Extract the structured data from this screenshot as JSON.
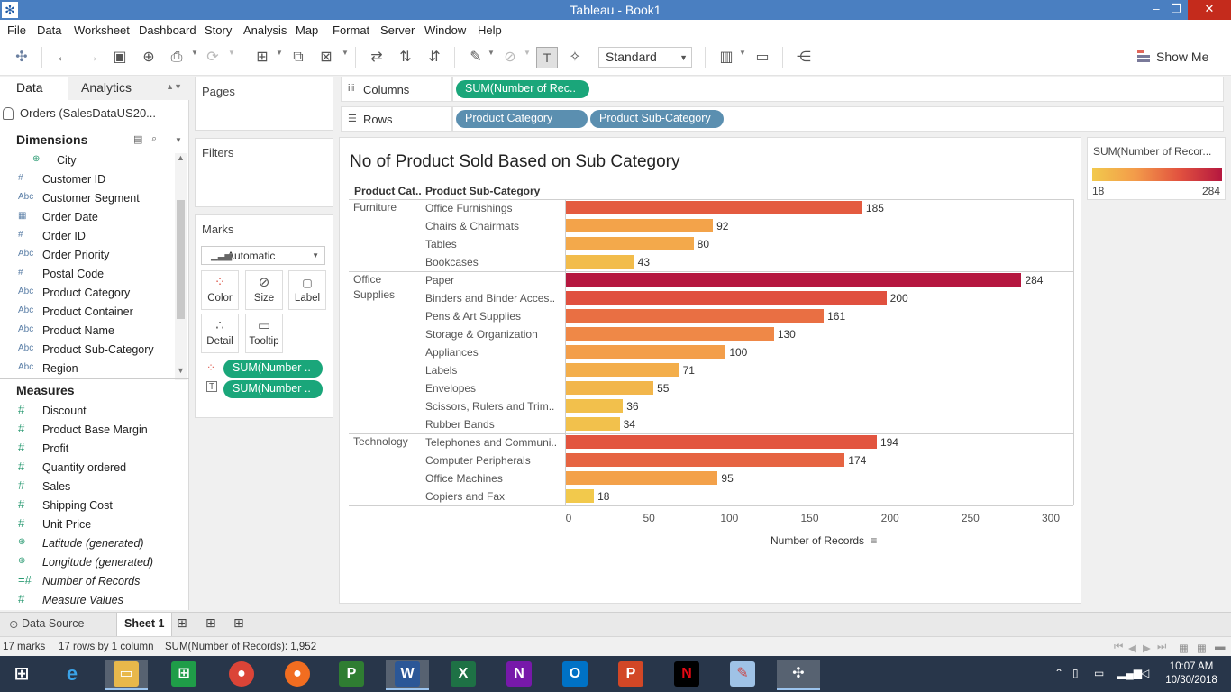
{
  "window": {
    "title": "Tableau - Book1"
  },
  "menu": [
    "File",
    "Data",
    "Worksheet",
    "Dashboard",
    "Story",
    "Analysis",
    "Map",
    "Format",
    "Server",
    "Window",
    "Help"
  ],
  "toolbar": {
    "view_size": "Standard",
    "show_me": "Show Me"
  },
  "data_pane": {
    "tab_data": "Data",
    "tab_analytics": "Analytics",
    "datasource": "Orders (SalesDataUS20...",
    "dimensions_label": "Dimensions",
    "measures_label": "Measures",
    "dimensions": [
      {
        "icon": "geo",
        "name": "City"
      },
      {
        "icon": "#",
        "name": "Customer ID"
      },
      {
        "icon": "Abc",
        "name": "Customer Segment"
      },
      {
        "icon": "date",
        "name": "Order Date"
      },
      {
        "icon": "#",
        "name": "Order ID"
      },
      {
        "icon": "Abc",
        "name": "Order Priority"
      },
      {
        "icon": "#",
        "name": "Postal Code"
      },
      {
        "icon": "Abc",
        "name": "Product Category"
      },
      {
        "icon": "Abc",
        "name": "Product Container"
      },
      {
        "icon": "Abc",
        "name": "Product Name"
      },
      {
        "icon": "Abc",
        "name": "Product Sub-Category"
      },
      {
        "icon": "Abc",
        "name": "Region"
      }
    ],
    "measures": [
      {
        "icon": "#",
        "name": "Discount"
      },
      {
        "icon": "#",
        "name": "Product Base Margin"
      },
      {
        "icon": "#",
        "name": "Profit"
      },
      {
        "icon": "#",
        "name": "Quantity ordered"
      },
      {
        "icon": "#",
        "name": "Sales"
      },
      {
        "icon": "#",
        "name": "Shipping Cost"
      },
      {
        "icon": "#",
        "name": "Unit Price"
      },
      {
        "icon": "geo",
        "name": "Latitude (generated)"
      },
      {
        "icon": "geo",
        "name": "Longitude (generated)"
      },
      {
        "icon": "=#",
        "name": "Number of Records"
      },
      {
        "icon": "#",
        "name": "Measure Values"
      }
    ]
  },
  "shelves": {
    "pages": "Pages",
    "filters": "Filters",
    "marks": "Marks",
    "mark_type": "Automatic",
    "mark_buttons": [
      "Color",
      "Size",
      "Label",
      "Detail",
      "Tooltip"
    ],
    "mark_pills": [
      "SUM(Number ..",
      "SUM(Number .."
    ],
    "columns_label": "Columns",
    "rows_label": "Rows",
    "columns_pills": [
      "SUM(Number of Rec.."
    ],
    "rows_pills": [
      "Product Category",
      "Product Sub-Category"
    ]
  },
  "legend": {
    "title": "SUM(Number of Recor...",
    "min": "18",
    "max": "284",
    "colors": [
      "#f2c94c",
      "#f39b4a",
      "#e2533f",
      "#b5173f"
    ]
  },
  "chart_data": {
    "type": "bar",
    "title": "No of Product Sold Based on Sub Category",
    "col_headers": [
      "Product Cat..",
      "Product Sub-Category"
    ],
    "xlabel": "Number of Records",
    "xlim": [
      0,
      300
    ],
    "ticks": [
      0,
      50,
      100,
      150,
      200,
      250,
      300
    ],
    "orientation": "horizontal",
    "groups": [
      {
        "category": "Furniture",
        "rows": [
          {
            "label": "Office Furnishings",
            "value": 185
          },
          {
            "label": "Chairs & Chairmats",
            "value": 92
          },
          {
            "label": "Tables",
            "value": 80
          },
          {
            "label": "Bookcases",
            "value": 43
          }
        ]
      },
      {
        "category": "Office\nSupplies",
        "rows": [
          {
            "label": "Paper",
            "value": 284
          },
          {
            "label": "Binders and Binder Acces..",
            "value": 200
          },
          {
            "label": "Pens & Art Supplies",
            "value": 161
          },
          {
            "label": "Storage & Organization",
            "value": 130
          },
          {
            "label": "Appliances",
            "value": 100
          },
          {
            "label": "Labels",
            "value": 71
          },
          {
            "label": "Envelopes",
            "value": 55
          },
          {
            "label": "Scissors, Rulers and Trim..",
            "value": 36
          },
          {
            "label": "Rubber Bands",
            "value": 34
          }
        ]
      },
      {
        "category": "Technology",
        "rows": [
          {
            "label": "Telephones and Communi..",
            "value": 194
          },
          {
            "label": "Computer Peripherals",
            "value": 174
          },
          {
            "label": "Office Machines",
            "value": 95
          },
          {
            "label": "Copiers and Fax",
            "value": 18
          }
        ]
      }
    ]
  },
  "sheet_tabs": {
    "data_source": "Data Source",
    "sheet": "Sheet 1"
  },
  "status": {
    "marks": "17 marks",
    "rows": "17 rows by 1 column",
    "sum": "SUM(Number of Records): 1,952"
  },
  "clock": {
    "time": "10:07 AM",
    "date": "10/30/2018"
  }
}
